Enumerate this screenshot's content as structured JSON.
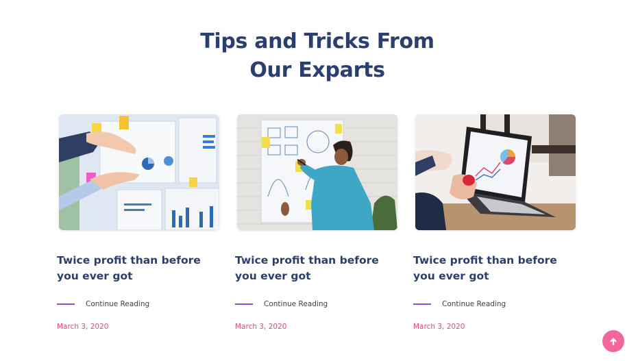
{
  "section": {
    "title_line1": "Tips and Tricks From",
    "title_line2": "Our Exparts"
  },
  "posts": [
    {
      "title": "Twice profit than before you ever got",
      "read_more": "Continue Reading",
      "date": "March 3, 2020",
      "image": "business-charts-meeting-image"
    },
    {
      "title": "Twice profit than before you ever got",
      "read_more": "Continue Reading",
      "date": "March 3, 2020",
      "image": "man-drawing-on-whiteboard-image"
    },
    {
      "title": "Twice profit than before you ever got",
      "read_more": "Continue Reading",
      "date": "March 3, 2020",
      "image": "laptop-analytics-image"
    }
  ],
  "colors": {
    "heading": "#2a3f6d",
    "accent_line": "#8a4fd0",
    "date": "#e04a77",
    "scroll_button": "#f4669a"
  },
  "scroll_top": {
    "icon": "arrow-up-icon"
  }
}
